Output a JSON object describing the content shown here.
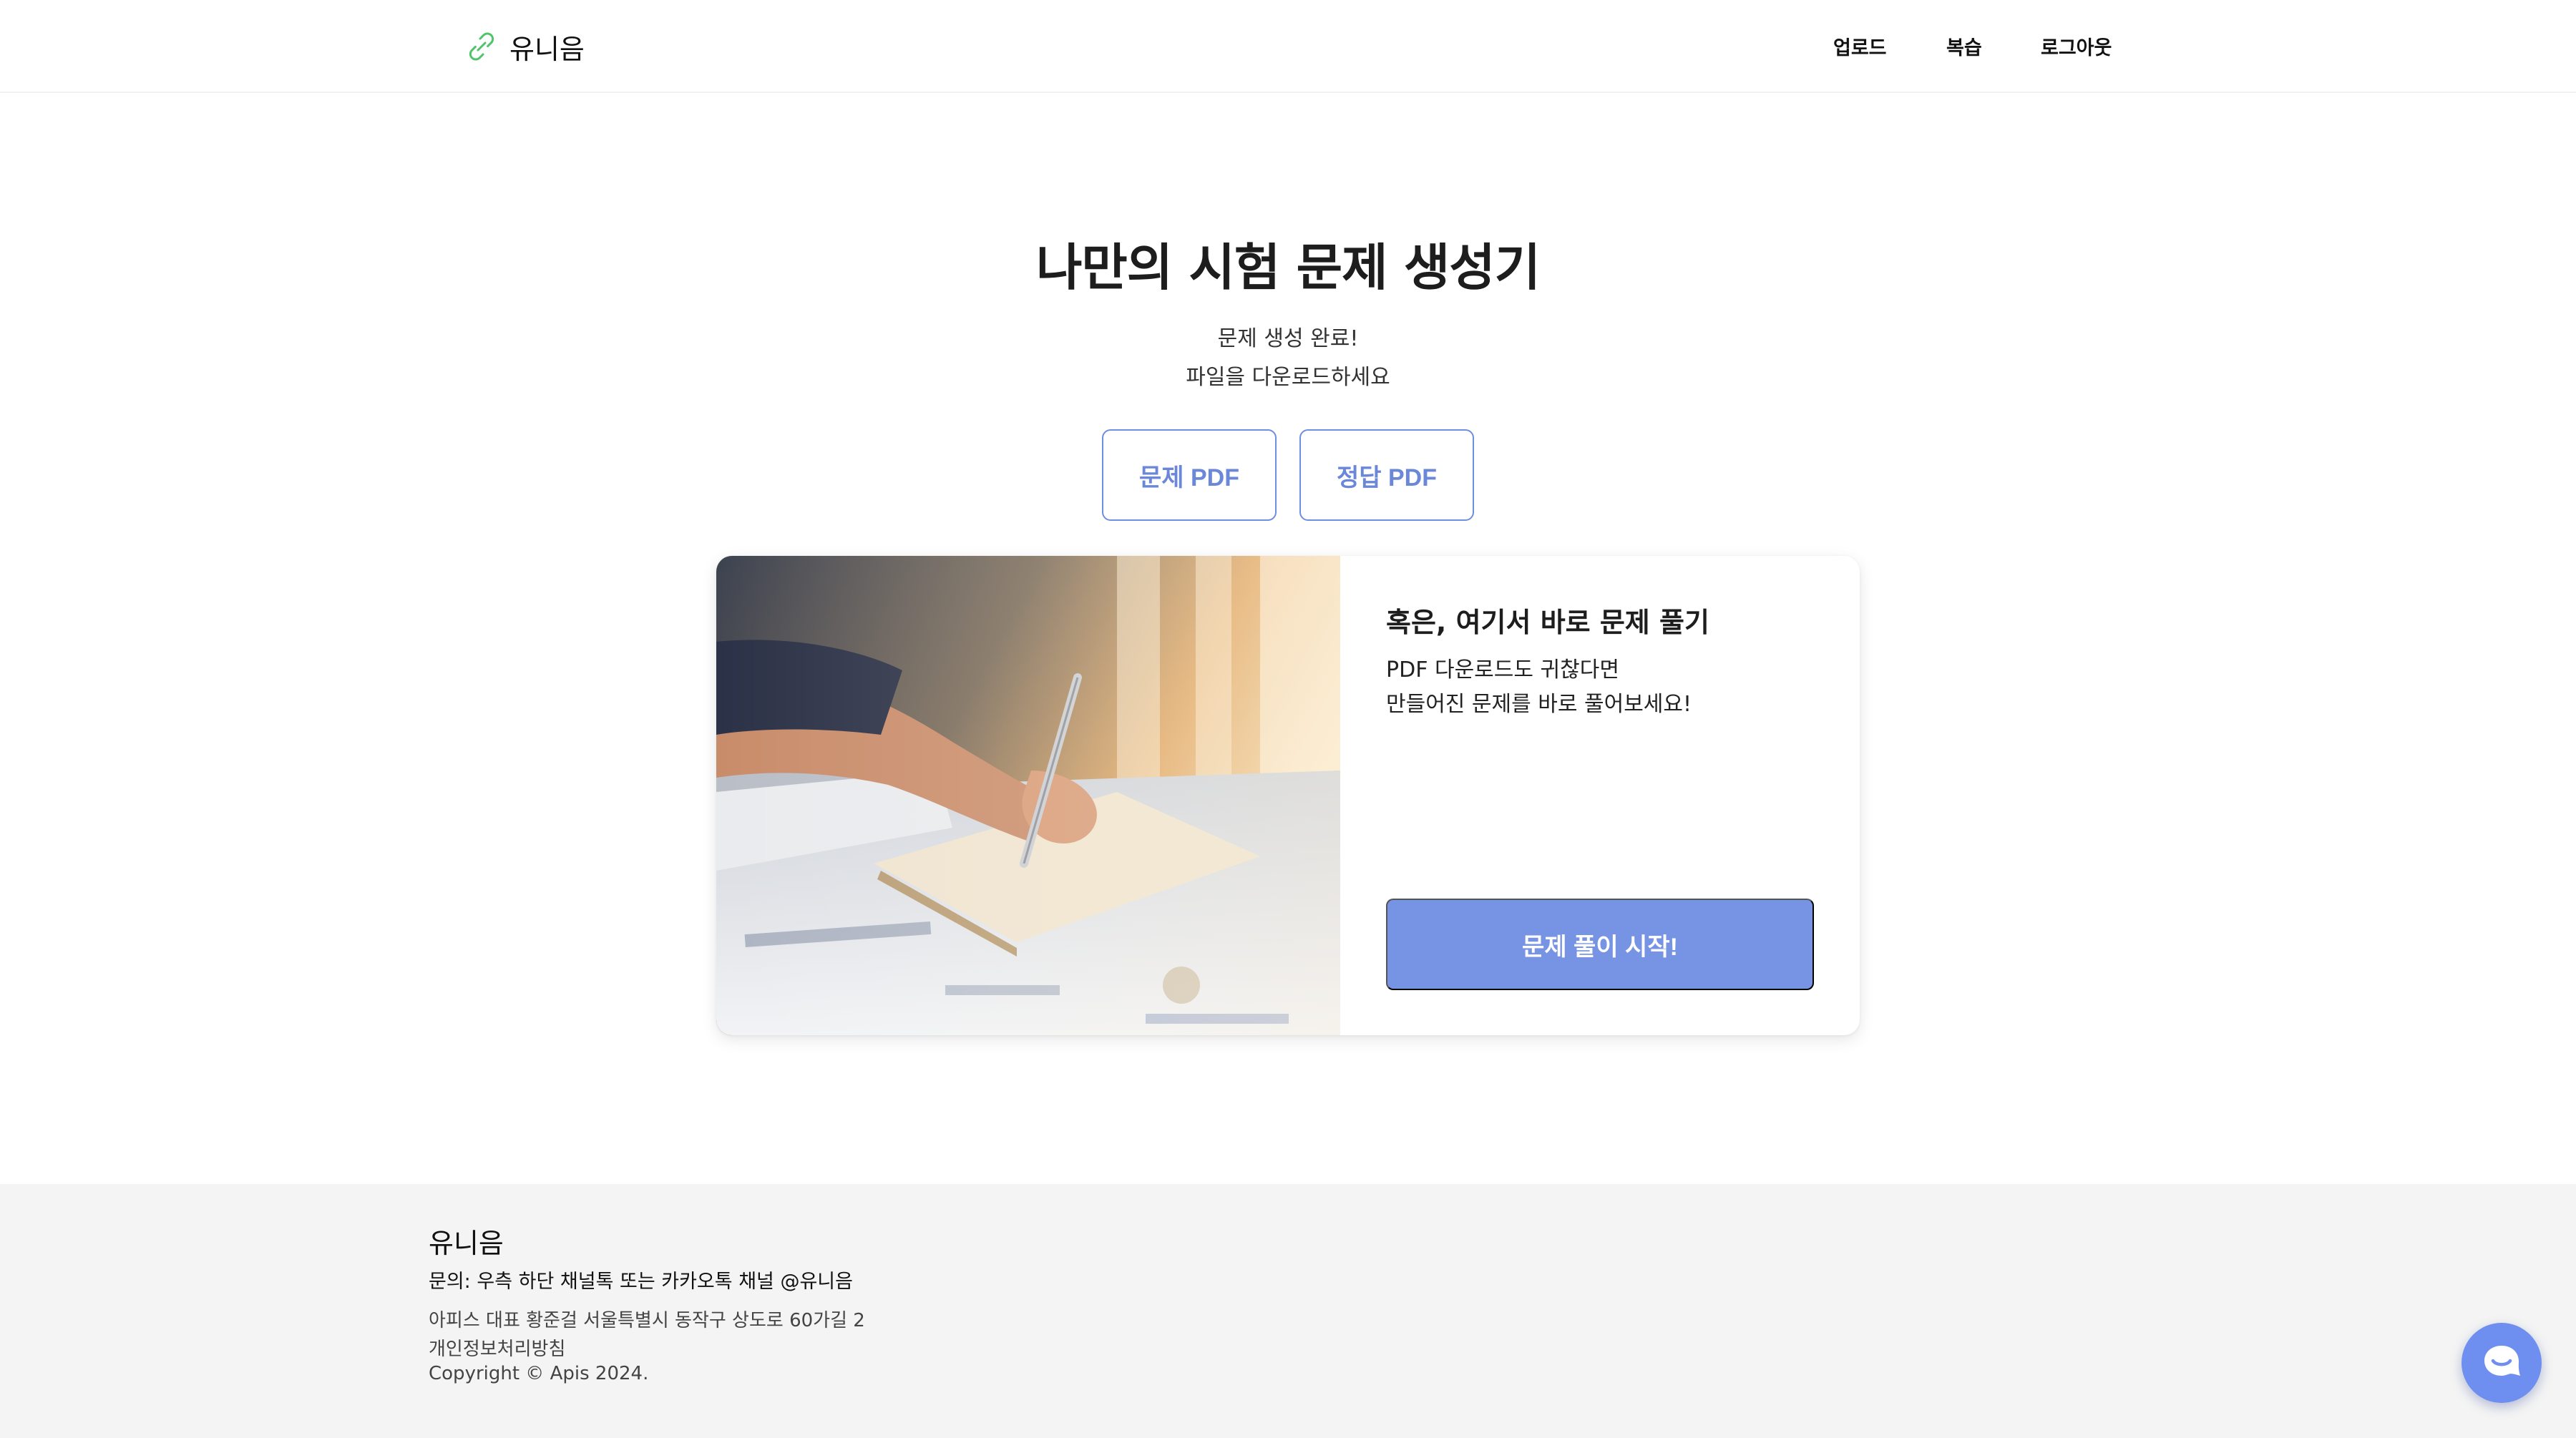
{
  "header": {
    "logo_text": "유니음",
    "logo_icon": "link-icon",
    "nav": {
      "upload": "업로드",
      "review": "복습",
      "logout": "로그아웃"
    }
  },
  "hero": {
    "title": "나만의 시험 문제 생성기",
    "status": "문제 생성 완료!",
    "instruction": "파일을 다운로드하세요",
    "buttons": {
      "question_pdf": "문제 PDF",
      "answer_pdf": "정답 PDF"
    }
  },
  "card": {
    "title": "혹은, 여기서 바로 문제 풀기",
    "desc_line1": "PDF 다운로드도 귀찮다면",
    "desc_line2": "만들어진 문제를 바로 풀어보세요!",
    "start_button": "문제 풀이 시작!",
    "image": "person-writing-photo"
  },
  "footer": {
    "brand": "유니음",
    "contact": "문의: 우측 하단 채널톡 또는 카카오톡 채널 @유니음",
    "address": "아피스 대표 황준걸 서울특별시 동작구 상도로 60가길 2",
    "privacy": "개인정보처리방침",
    "copyright": "Copyright © Apis 2024."
  },
  "chat": {
    "icon": "chat-bubble-icon"
  },
  "colors": {
    "accent": "#7793e3",
    "accent_border": "#6f8ee0",
    "logo_green": "#4fc46a",
    "footer_bg": "#f4f4f4"
  }
}
